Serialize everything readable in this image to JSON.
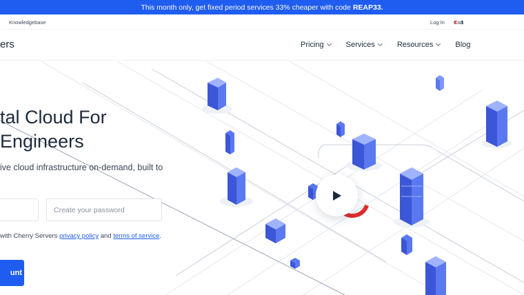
{
  "promo": {
    "text": "This month only, get fixed period services 33% cheaper with code",
    "code": "REAP33."
  },
  "utility": {
    "knowledgebase": "Knowledgebase",
    "login": "Log In",
    "cart": "Cart",
    "currency_symbol": "€",
    "currency_code": "$"
  },
  "nav": {
    "brand": "ers",
    "items": [
      {
        "label": "Pricing",
        "has_dropdown": true
      },
      {
        "label": "Services",
        "has_dropdown": true
      },
      {
        "label": "Resources",
        "has_dropdown": true
      },
      {
        "label": "Blog",
        "has_dropdown": false
      }
    ]
  },
  "hero": {
    "title_line1": "tal Cloud For",
    "title_line2": "Engineers",
    "subtitle_line1": "ive cloud infrastructure on-demand, built to",
    "password_placeholder": "Create your password",
    "consent_prefix": "with Cherry Servers",
    "privacy_link": "privacy policy",
    "consent_and": "and",
    "terms_link": "terms of service",
    "consent_suffix": ".",
    "cta_label": "unt"
  },
  "icons": {
    "play": "play-icon",
    "chevron": "chevron-down-icon",
    "buildings": "isometric-server-buildings"
  },
  "colors": {
    "brand_blue": "#1f5cf0",
    "accent_red": "#e02b2b",
    "building_blue": "#4a63e8"
  }
}
